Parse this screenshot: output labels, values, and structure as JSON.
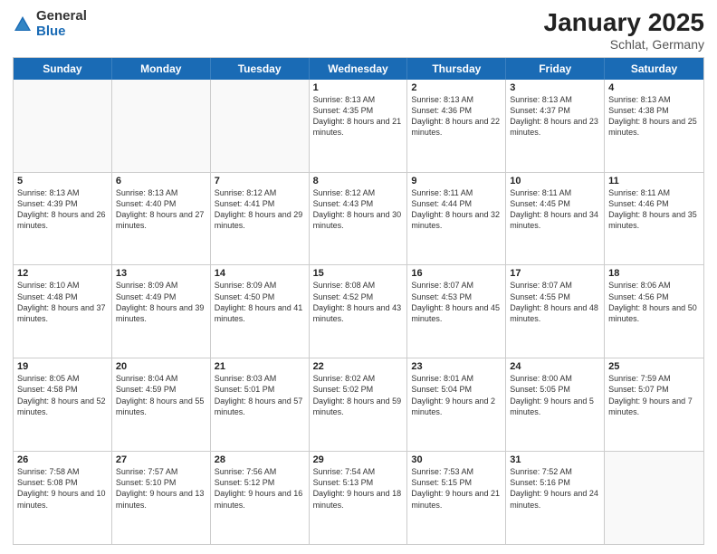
{
  "logo": {
    "general": "General",
    "blue": "Blue"
  },
  "title": "January 2025",
  "subtitle": "Schlat, Germany",
  "days": [
    "Sunday",
    "Monday",
    "Tuesday",
    "Wednesday",
    "Thursday",
    "Friday",
    "Saturday"
  ],
  "weeks": [
    [
      {
        "day": "",
        "info": ""
      },
      {
        "day": "",
        "info": ""
      },
      {
        "day": "",
        "info": ""
      },
      {
        "day": "1",
        "info": "Sunrise: 8:13 AM\nSunset: 4:35 PM\nDaylight: 8 hours\nand 21 minutes."
      },
      {
        "day": "2",
        "info": "Sunrise: 8:13 AM\nSunset: 4:36 PM\nDaylight: 8 hours\nand 22 minutes."
      },
      {
        "day": "3",
        "info": "Sunrise: 8:13 AM\nSunset: 4:37 PM\nDaylight: 8 hours\nand 23 minutes."
      },
      {
        "day": "4",
        "info": "Sunrise: 8:13 AM\nSunset: 4:38 PM\nDaylight: 8 hours\nand 25 minutes."
      }
    ],
    [
      {
        "day": "5",
        "info": "Sunrise: 8:13 AM\nSunset: 4:39 PM\nDaylight: 8 hours\nand 26 minutes."
      },
      {
        "day": "6",
        "info": "Sunrise: 8:13 AM\nSunset: 4:40 PM\nDaylight: 8 hours\nand 27 minutes."
      },
      {
        "day": "7",
        "info": "Sunrise: 8:12 AM\nSunset: 4:41 PM\nDaylight: 8 hours\nand 29 minutes."
      },
      {
        "day": "8",
        "info": "Sunrise: 8:12 AM\nSunset: 4:43 PM\nDaylight: 8 hours\nand 30 minutes."
      },
      {
        "day": "9",
        "info": "Sunrise: 8:11 AM\nSunset: 4:44 PM\nDaylight: 8 hours\nand 32 minutes."
      },
      {
        "day": "10",
        "info": "Sunrise: 8:11 AM\nSunset: 4:45 PM\nDaylight: 8 hours\nand 34 minutes."
      },
      {
        "day": "11",
        "info": "Sunrise: 8:11 AM\nSunset: 4:46 PM\nDaylight: 8 hours\nand 35 minutes."
      }
    ],
    [
      {
        "day": "12",
        "info": "Sunrise: 8:10 AM\nSunset: 4:48 PM\nDaylight: 8 hours\nand 37 minutes."
      },
      {
        "day": "13",
        "info": "Sunrise: 8:09 AM\nSunset: 4:49 PM\nDaylight: 8 hours\nand 39 minutes."
      },
      {
        "day": "14",
        "info": "Sunrise: 8:09 AM\nSunset: 4:50 PM\nDaylight: 8 hours\nand 41 minutes."
      },
      {
        "day": "15",
        "info": "Sunrise: 8:08 AM\nSunset: 4:52 PM\nDaylight: 8 hours\nand 43 minutes."
      },
      {
        "day": "16",
        "info": "Sunrise: 8:07 AM\nSunset: 4:53 PM\nDaylight: 8 hours\nand 45 minutes."
      },
      {
        "day": "17",
        "info": "Sunrise: 8:07 AM\nSunset: 4:55 PM\nDaylight: 8 hours\nand 48 minutes."
      },
      {
        "day": "18",
        "info": "Sunrise: 8:06 AM\nSunset: 4:56 PM\nDaylight: 8 hours\nand 50 minutes."
      }
    ],
    [
      {
        "day": "19",
        "info": "Sunrise: 8:05 AM\nSunset: 4:58 PM\nDaylight: 8 hours\nand 52 minutes."
      },
      {
        "day": "20",
        "info": "Sunrise: 8:04 AM\nSunset: 4:59 PM\nDaylight: 8 hours\nand 55 minutes."
      },
      {
        "day": "21",
        "info": "Sunrise: 8:03 AM\nSunset: 5:01 PM\nDaylight: 8 hours\nand 57 minutes."
      },
      {
        "day": "22",
        "info": "Sunrise: 8:02 AM\nSunset: 5:02 PM\nDaylight: 8 hours\nand 59 minutes."
      },
      {
        "day": "23",
        "info": "Sunrise: 8:01 AM\nSunset: 5:04 PM\nDaylight: 9 hours\nand 2 minutes."
      },
      {
        "day": "24",
        "info": "Sunrise: 8:00 AM\nSunset: 5:05 PM\nDaylight: 9 hours\nand 5 minutes."
      },
      {
        "day": "25",
        "info": "Sunrise: 7:59 AM\nSunset: 5:07 PM\nDaylight: 9 hours\nand 7 minutes."
      }
    ],
    [
      {
        "day": "26",
        "info": "Sunrise: 7:58 AM\nSunset: 5:08 PM\nDaylight: 9 hours\nand 10 minutes."
      },
      {
        "day": "27",
        "info": "Sunrise: 7:57 AM\nSunset: 5:10 PM\nDaylight: 9 hours\nand 13 minutes."
      },
      {
        "day": "28",
        "info": "Sunrise: 7:56 AM\nSunset: 5:12 PM\nDaylight: 9 hours\nand 16 minutes."
      },
      {
        "day": "29",
        "info": "Sunrise: 7:54 AM\nSunset: 5:13 PM\nDaylight: 9 hours\nand 18 minutes."
      },
      {
        "day": "30",
        "info": "Sunrise: 7:53 AM\nSunset: 5:15 PM\nDaylight: 9 hours\nand 21 minutes."
      },
      {
        "day": "31",
        "info": "Sunrise: 7:52 AM\nSunset: 5:16 PM\nDaylight: 9 hours\nand 24 minutes."
      },
      {
        "day": "",
        "info": ""
      }
    ]
  ]
}
